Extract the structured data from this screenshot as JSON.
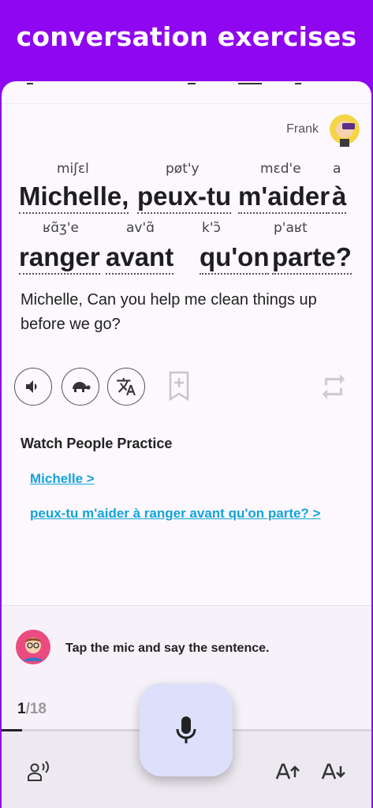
{
  "banner": {
    "title": "conversation exercises"
  },
  "speaker": {
    "name": "Frank"
  },
  "sentence": {
    "words_line1": [
      {
        "word": "Michelle,",
        "ipa": "miʃɛl"
      },
      {
        "word": "peux-tu",
        "ipa": "pøt'y"
      },
      {
        "word": "m'aider",
        "ipa": "mɛd'e"
      },
      {
        "word": "à",
        "ipa": "a"
      }
    ],
    "words_line2": [
      {
        "word": "ranger",
        "ipa": "ʁɑ̃ʒ'e"
      },
      {
        "word": "avant",
        "ipa": "av'ɑ̃"
      },
      {
        "word": "qu'on",
        "ipa": "k'ɔ̃"
      },
      {
        "word": "parte?",
        "ipa": "p'aʁt"
      }
    ],
    "translation": "Michelle, Can you help me clean things up before we go?"
  },
  "actions": {
    "icons": [
      "volume-icon",
      "turtle-slow-icon",
      "translate-icon",
      "bookmark-add-icon",
      "repeat-icon"
    ]
  },
  "watch": {
    "title": "Watch People Practice",
    "links": [
      "Michelle >",
      "peux-tu m'aider à ranger avant qu'on parte? >"
    ]
  },
  "practice": {
    "prompt": "Tap the mic and say the sentence.",
    "progress_current": "1",
    "progress_total": "/18",
    "progress_fraction": 0.056
  },
  "nav": {
    "icons": [
      "speaking-person-icon",
      "microphone-icon",
      "font-increase-icon",
      "font-decrease-icon"
    ]
  },
  "colors": {
    "accent": "#8f06f0",
    "link": "#13a3da",
    "mic_bg": "#dde0fb"
  }
}
